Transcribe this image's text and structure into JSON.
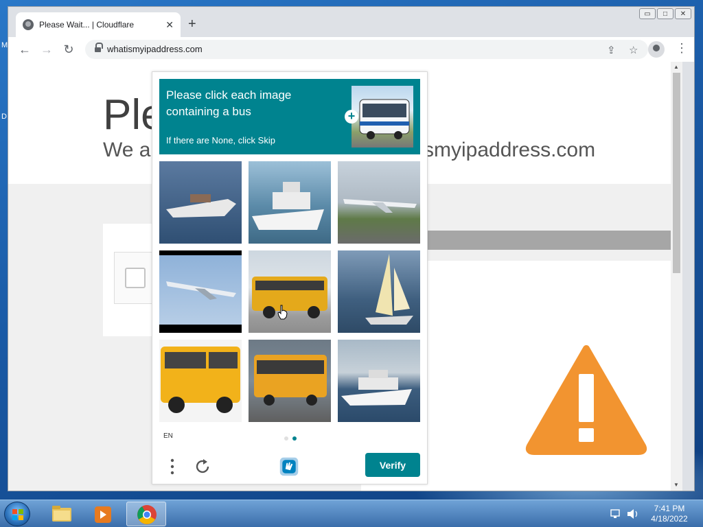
{
  "desktop": {
    "labels": [
      "M",
      "D"
    ]
  },
  "browser": {
    "tab_title": "Please Wait... | Cloudflare",
    "url": "whatismyipaddress.com",
    "win_controls": [
      "▭",
      "□",
      "✕"
    ]
  },
  "page": {
    "title_partial": "Ple",
    "subtitle_partial": "We ar",
    "subtitle_right": "smyipaddress.com",
    "warning_color": "#f29430"
  },
  "captcha": {
    "prompt": "Please click each image containing a bus",
    "hint": "If there are None, click Skip",
    "language": "EN",
    "verify_label": "Verify",
    "accent_color": "#00838f",
    "tiles": [
      {
        "subject": "speedboat"
      },
      {
        "subject": "yacht"
      },
      {
        "subject": "airplane on runway"
      },
      {
        "subject": "airplane in flight"
      },
      {
        "subject": "school bus"
      },
      {
        "subject": "sailboat"
      },
      {
        "subject": "school bus"
      },
      {
        "subject": "city bus"
      },
      {
        "subject": "yacht"
      }
    ],
    "pages": [
      {
        "active": false
      },
      {
        "active": true
      }
    ]
  },
  "taskbar": {
    "time": "7:41 PM",
    "date": "4/18/2022"
  }
}
